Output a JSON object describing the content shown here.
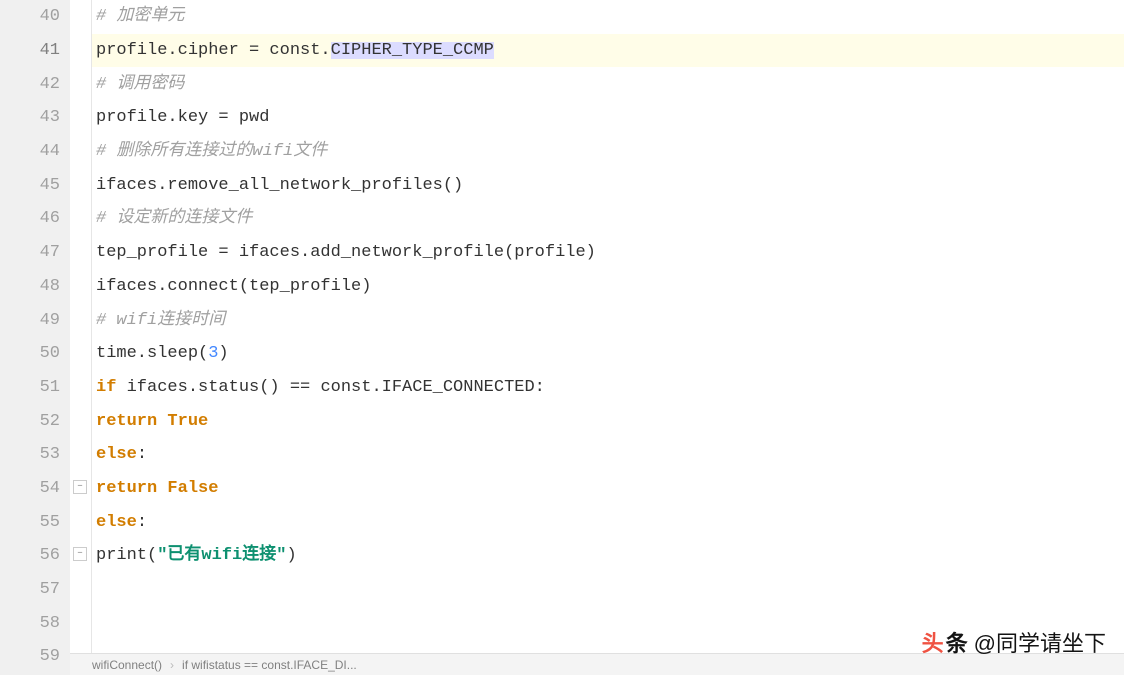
{
  "gutter": {
    "start": 40,
    "end": 59,
    "current": 41
  },
  "indent_unit": "    ",
  "lines": {
    "l40": {
      "indent": 4,
      "comment": "# 加密单元"
    },
    "l41": {
      "indent": 4,
      "pre": "profile.cipher = const.",
      "sel": "CIPHER_TYPE_CCMP"
    },
    "l42": {
      "indent": 4,
      "comment": "# 调用密码"
    },
    "l43": {
      "indent": 4,
      "text": "profile.key = pwd"
    },
    "l44": {
      "indent": 4,
      "comment": "# 删除所有连接过的wifi文件"
    },
    "l45": {
      "indent": 4,
      "text": "ifaces.remove_all_network_profiles()"
    },
    "l46": {
      "indent": 4,
      "comment": "# 设定新的连接文件"
    },
    "l47": {
      "indent": 4,
      "text": "tep_profile = ifaces.add_network_profile(profile)"
    },
    "l48": {
      "indent": 4,
      "text": "ifaces.connect(tep_profile)"
    },
    "l49": {
      "indent": 4,
      "comment": "# wifi连接时间"
    },
    "l50": {
      "indent": 4,
      "pre": "time.sleep(",
      "num": "3",
      "post": ")"
    },
    "l51": {
      "indent": 4,
      "kw": "if",
      "rest": " ifaces.status() == const.IFACE_CONNECTED:"
    },
    "l52": {
      "indent": 5,
      "kw": "return True"
    },
    "l53": {
      "indent": 4,
      "kw": "else",
      "rest": ":"
    },
    "l54": {
      "indent": 5,
      "kw": "return False"
    },
    "l55": {
      "indent": 3,
      "kw": "else",
      "rest": ":"
    },
    "l56": {
      "indent": 4,
      "pre": "print(",
      "q": "\"",
      "str": "已有wifi连接",
      "post": ")"
    },
    "l57": {
      "indent": 0,
      "text": ""
    },
    "l58": {
      "indent": 0,
      "text": ""
    },
    "l59": {
      "indent": 0,
      "text": ""
    }
  },
  "breadcrumb": {
    "item1": "wifiConnect()",
    "item2": "if wifistatus == const.IFACE_DI..."
  },
  "watermark": {
    "brand1": "头",
    "brand2": "条",
    "handle": "@同学请坐下"
  }
}
